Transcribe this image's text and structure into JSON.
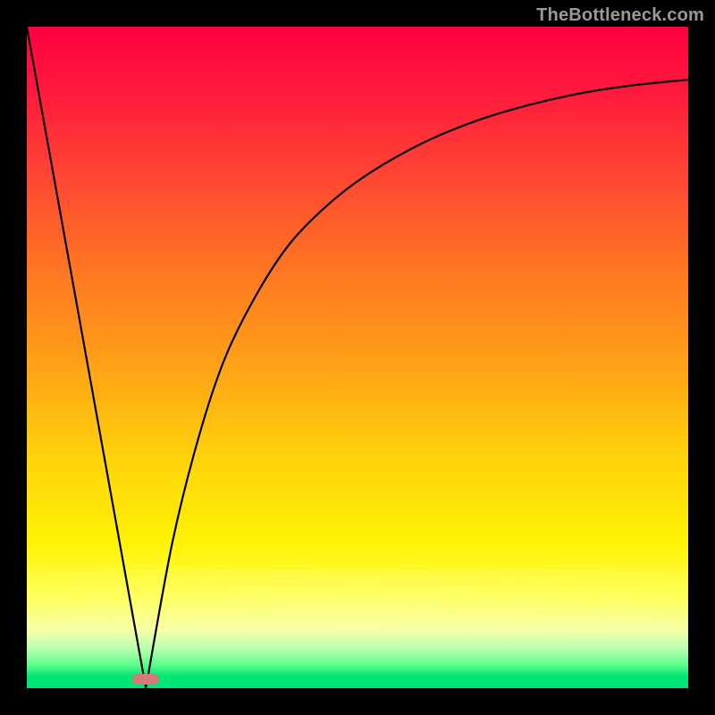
{
  "watermark": "TheBottleneck.com",
  "marker": {
    "x_fraction": 0.18,
    "y_fraction": 0.99
  },
  "chart_data": {
    "type": "line",
    "title": "",
    "xlabel": "",
    "ylabel": "",
    "xlim": [
      0,
      100
    ],
    "ylim": [
      0,
      100
    ],
    "grid": false,
    "legend": false,
    "background_gradient": {
      "direction": "vertical",
      "stops": [
        {
          "pos": 0.0,
          "color": "#ff0040"
        },
        {
          "pos": 0.22,
          "color": "#ff4433"
        },
        {
          "pos": 0.52,
          "color": "#ffa416"
        },
        {
          "pos": 0.78,
          "color": "#fff205"
        },
        {
          "pos": 0.96,
          "color": "#5cff8a"
        },
        {
          "pos": 1.0,
          "color": "#00e676"
        }
      ]
    },
    "series": [
      {
        "name": "left-line",
        "kind": "straight",
        "x": [
          0,
          18
        ],
        "y": [
          100,
          0
        ]
      },
      {
        "name": "right-curve",
        "kind": "curve",
        "x": [
          18,
          22,
          26,
          30,
          35,
          40,
          46,
          52,
          60,
          68,
          76,
          84,
          92,
          100
        ],
        "y": [
          0,
          22,
          38,
          50,
          60,
          67.5,
          73.5,
          78,
          82.5,
          85.8,
          88.2,
          90,
          91.2,
          92
        ]
      }
    ],
    "annotations": [
      {
        "name": "minimum-marker",
        "x": 18,
        "y": 0.5,
        "shape": "pill",
        "color": "#d47a7a"
      }
    ]
  }
}
